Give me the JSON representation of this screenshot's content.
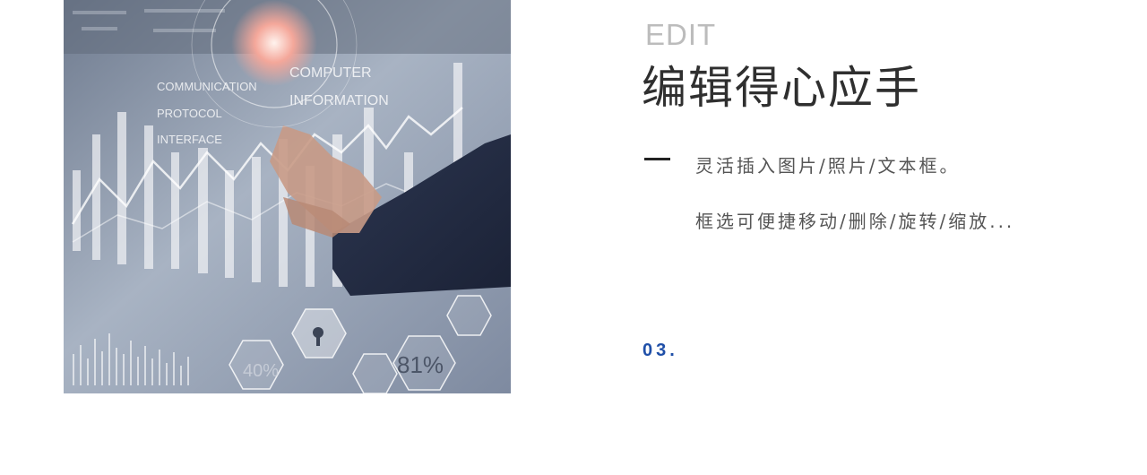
{
  "image": {
    "overlay_text": {
      "communication": "COMMUNICATION",
      "protocol": "PROTOCOL",
      "interface": "INTERFACE",
      "computer": "COMPUTER",
      "information": "INFORMATION",
      "percent_40": "40%",
      "percent_81": "81%"
    }
  },
  "content": {
    "edit_label": "EDIT",
    "title": "编辑得心应手",
    "line_1": "灵活插入图片/照片/文本框。",
    "line_2": "框选可便捷移动/删除/旋转/缩放...",
    "page_number": "03."
  },
  "colors": {
    "title": "#2f2f2f",
    "edit_label": "#bcbcbc",
    "body_text": "#555555",
    "page_number": "#1f4fa8"
  }
}
